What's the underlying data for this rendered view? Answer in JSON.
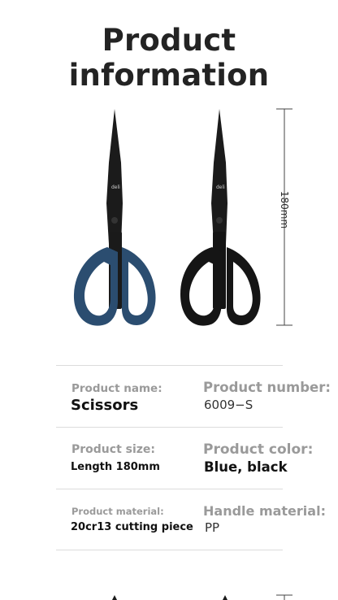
{
  "page_title": "Product information",
  "dimension": {
    "length_label": "180mm"
  },
  "specs": {
    "product_name": {
      "label": "Product name:",
      "value": "Scissors"
    },
    "product_number": {
      "label": "Product number:",
      "value": "6009−S"
    },
    "product_size": {
      "label": "Product size:",
      "value": "Length 180mm"
    },
    "product_color": {
      "label": "Product color:",
      "value": "Blue, black"
    },
    "product_material": {
      "label": "Product material:",
      "value": "20cr13 cutting piece"
    },
    "handle_material": {
      "label": "Handle material:",
      "value": "PP"
    }
  },
  "brand_mark": "deli",
  "colors": {
    "blue_handle": "#2b4d70",
    "black_handle": "#151515",
    "blade": "#1b1b1b"
  }
}
